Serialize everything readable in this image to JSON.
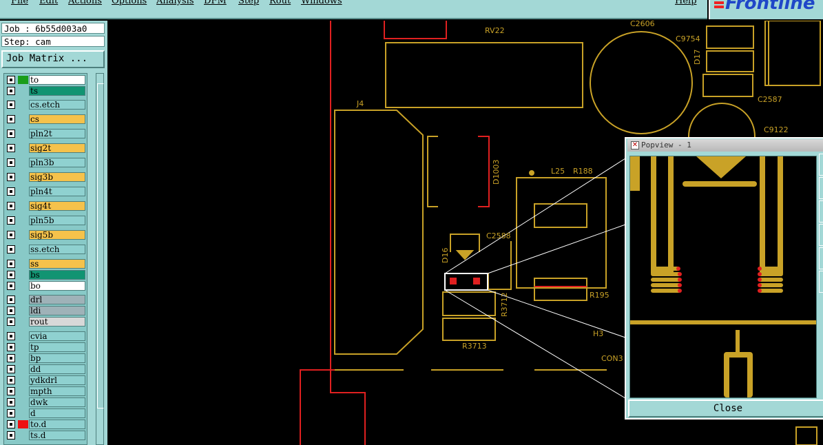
{
  "menu": [
    "File",
    "Edit",
    "Actions",
    "Options",
    "Analysis",
    "DFM",
    "Step",
    "Rout",
    "Windows"
  ],
  "help": "Help",
  "logo": "Frontline",
  "job": "Job : 6b55d003a0",
  "step": "Step: cam",
  "job_matrix": "Job Matrix ...",
  "layers": [
    {
      "name": "to",
      "color": "#ffffff",
      "swatch": "#1a9d1a"
    },
    {
      "name": "ts",
      "color": "#119472"
    },
    {
      "name": "cs.etch",
      "color": "#8fd1d0"
    },
    {
      "name": "cs",
      "color": "#f5c24b"
    },
    {
      "name": "pln2t",
      "color": "#8fd1d0"
    },
    {
      "name": "sig2t",
      "color": "#f5c24b"
    },
    {
      "name": "pln3b",
      "color": "#8fd1d0"
    },
    {
      "name": "sig3b",
      "color": "#f5c24b"
    },
    {
      "name": "pln4t",
      "color": "#8fd1d0"
    },
    {
      "name": "sig4t",
      "color": "#f5c24b"
    },
    {
      "name": "pln5b",
      "color": "#8fd1d0"
    },
    {
      "name": "sig5b",
      "color": "#f5c24b"
    },
    {
      "name": "ss.etch",
      "color": "#8fd1d0"
    },
    {
      "name": "ss",
      "color": "#f5c24b"
    },
    {
      "name": "bs",
      "color": "#119472"
    },
    {
      "name": "bo",
      "color": "#ffffff"
    },
    {
      "name": "drl",
      "color": "#9fb2b8"
    },
    {
      "name": "ldi",
      "color": "#9fb2b8"
    },
    {
      "name": "rout",
      "color": "#d8d8d8"
    },
    {
      "name": "cvia",
      "color": "#8fd1d0"
    },
    {
      "name": "tp",
      "color": "#8fd1d0"
    },
    {
      "name": "bp",
      "color": "#8fd1d0"
    },
    {
      "name": "dd",
      "color": "#8fd1d0"
    },
    {
      "name": "ydkdrl",
      "color": "#8fd1d0"
    },
    {
      "name": "mpth",
      "color": "#8fd1d0"
    },
    {
      "name": "dwk",
      "color": "#8fd1d0"
    },
    {
      "name": "d",
      "color": "#8fd1d0"
    },
    {
      "name": "to.d",
      "color": "#8fd1d0",
      "swatch": "#ee1111"
    },
    {
      "name": "ts.d",
      "color": "#8fd1d0"
    }
  ],
  "board_labels": [
    "RV22",
    "C2606",
    "C9754",
    "D17",
    "C2587",
    "C9122",
    "J4",
    "D1003",
    "L25",
    "R188",
    "C2588",
    "D16",
    "R195",
    "R3712",
    "R3713",
    "H3",
    "CON3"
  ],
  "popview": {
    "title": "Popview - 1",
    "close": "Close"
  },
  "colors": {
    "panel": "#a3d8d6",
    "trace": "#c9a227",
    "red": "#e02020"
  }
}
